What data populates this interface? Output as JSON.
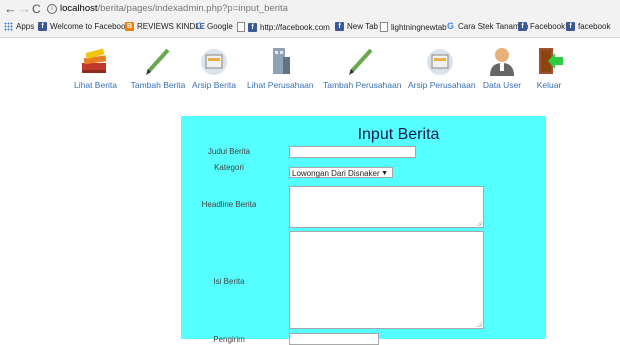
{
  "browser": {
    "url_host": "localhost",
    "url_path": "/berita/pages/indexadmin.php?p=input_berita",
    "bookmarks": [
      {
        "label": "Apps",
        "icon": "apps-grid-icon"
      },
      {
        "label": "Welcome to Faceboo",
        "icon": "facebook-icon"
      },
      {
        "label": "REVIEWS KINDLE",
        "icon": "blogger-icon"
      },
      {
        "label": "Google",
        "icon": "google-icon"
      },
      {
        "label": "http://facebook.com",
        "icon": "page-icon"
      },
      {
        "label": "New Tab",
        "icon": "facebook-icon"
      },
      {
        "label": "lightningnewtab",
        "icon": "page-icon"
      },
      {
        "label": "Cara Stek Tanaman",
        "icon": "google-icon"
      },
      {
        "label": "Facebook",
        "icon": "facebook-icon"
      },
      {
        "label": "facebook",
        "icon": "facebook-icon"
      }
    ]
  },
  "menu": [
    {
      "label": "Lihat Berita",
      "icon": "books-icon"
    },
    {
      "label": "Tambah Berita",
      "icon": "pencil-icon"
    },
    {
      "label": "Arsip Berita",
      "icon": "archive-icon"
    },
    {
      "label": "Lihat Perusahaan",
      "icon": "building-icon"
    },
    {
      "label": "Tambah Perusahaan",
      "icon": "pencil-icon"
    },
    {
      "label": "Arsip Perusahaan",
      "icon": "archive-icon"
    },
    {
      "label": "Data User",
      "icon": "user-icon"
    },
    {
      "label": "Keluar",
      "icon": "exit-icon"
    }
  ],
  "form": {
    "title": "Input Berita",
    "judul_label": "Judul Berita",
    "judul_value": "",
    "kategori_label": "Kategori",
    "kategori_value": "Lowongan Dari Disnaker",
    "headline_label": "Headline Berita",
    "isi_label": "Isi Berita",
    "pengirim_label": "Pengirim"
  },
  "colors": {
    "panel": "#55ffff",
    "menu_text": "#3a6fb0"
  }
}
